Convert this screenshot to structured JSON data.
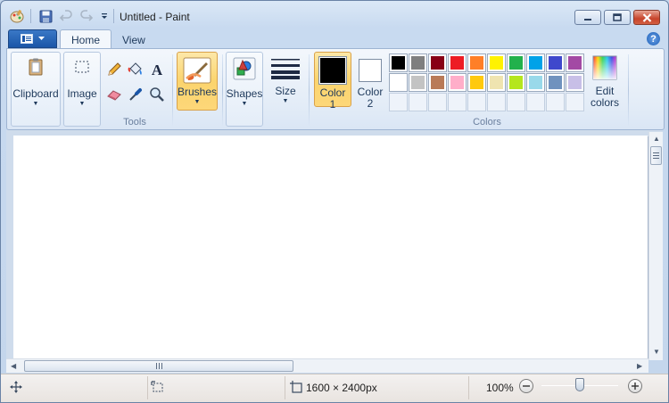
{
  "window": {
    "title": "Untitled - Paint",
    "controls": [
      "minimize",
      "maximize",
      "close"
    ]
  },
  "quick_access": {
    "icons": [
      "paint-app-icon",
      "save-icon",
      "undo-icon",
      "redo-icon",
      "customize-dropdown-icon"
    ]
  },
  "ribbon": {
    "tabs": [
      {
        "label": "Home",
        "active": true
      },
      {
        "label": "View",
        "active": false
      }
    ],
    "groups": {
      "clipboard": {
        "label": "Clipboard"
      },
      "image": {
        "label": "Image"
      },
      "tools": {
        "label": "Tools"
      },
      "brushes": {
        "label": "Brushes"
      },
      "shapes": {
        "label": "Shapes"
      },
      "size": {
        "label": "Size"
      },
      "colors": {
        "label": "Colors"
      }
    },
    "color1_label": "Color",
    "color1_num": "1",
    "color2_label": "Color",
    "color2_num": "2",
    "edit_colors_line1": "Edit",
    "edit_colors_line2": "colors",
    "color1": "#000000",
    "color2": "#ffffff",
    "palette_row1": [
      "#000000",
      "#7f7f7f",
      "#880015",
      "#ed1c24",
      "#ff7f27",
      "#fff200",
      "#22b14c",
      "#00a2e8",
      "#3f48cc",
      "#a349a4"
    ],
    "palette_row2": [
      "#ffffff",
      "#c3c3c3",
      "#b97a57",
      "#ffaec9",
      "#ffc90e",
      "#efe4b0",
      "#b5e61d",
      "#99d9ea",
      "#7092be",
      "#c8bfe7"
    ],
    "palette_row3_empty": 10
  },
  "status": {
    "image_size": "1600 × 2400px",
    "zoom": "100%"
  }
}
